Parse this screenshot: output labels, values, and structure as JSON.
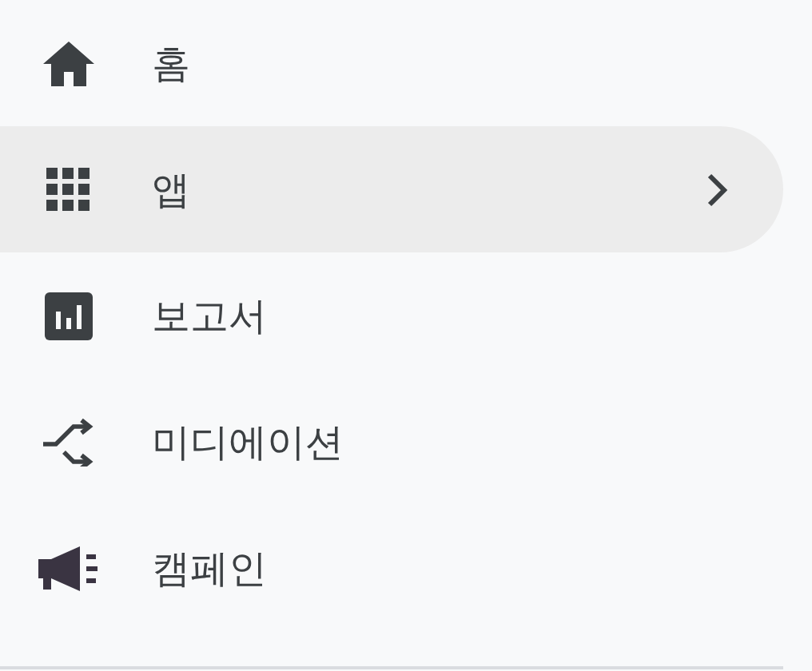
{
  "nav": {
    "items": [
      {
        "label": "홈",
        "selected": false,
        "submenu": false
      },
      {
        "label": "앱",
        "selected": true,
        "submenu": true
      },
      {
        "label": "보고서",
        "selected": false,
        "submenu": false
      },
      {
        "label": "미디에이션",
        "selected": false,
        "submenu": false
      },
      {
        "label": "캠페인",
        "selected": false,
        "submenu": false
      }
    ]
  }
}
